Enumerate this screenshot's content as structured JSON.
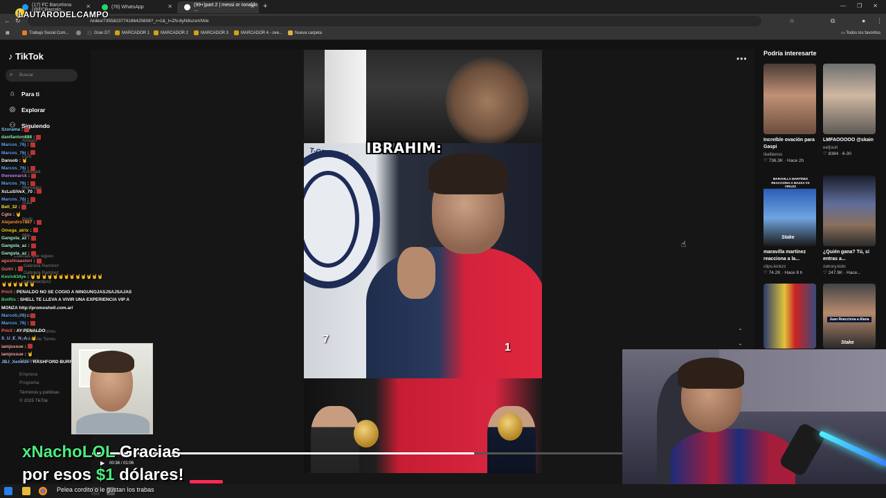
{
  "browser": {
    "tabs": [
      {
        "label": "(17) FC Barcelona (@FCBarcelo...",
        "icon_color": "#1d9bf0"
      },
      {
        "label": "(76) WhatsApp",
        "icon_color": "#25d366"
      },
      {
        "label": "(99+)part 2 | messi or ronaldo ...",
        "icon_color": "#ffffff"
      }
    ],
    "url": "/video/7355823774186425606?_r=1&_t=ZN-8yN8szsmNVe",
    "bookmarks": [
      "Trabajo Social Com...",
      "Gran DT",
      "MARCADOR 1",
      "MARCADOR 2",
      "MARCADOR 3",
      "MARCADOR 4 - ove...",
      "Nueva carpeta"
    ],
    "all_bookmarks": "Todos los favoritos",
    "new_tab": "+"
  },
  "stream_logo": "LAUTARODELCAMPO",
  "tiktok": {
    "logo": "TikTok",
    "search_placeholder": "Buscar",
    "nav": [
      {
        "label": "Para ti",
        "icon": "home-icon"
      },
      {
        "label": "Explorar",
        "icon": "compass-icon"
      },
      {
        "label": "Siguiendo",
        "icon": "users-icon"
      }
    ],
    "faint_items": [
      "Amigos",
      "LIVE",
      "Actividad",
      "Mensajes",
      "Subir",
      "Perfil",
      "Más",
      "Cuentas que sigues",
      "Gabriela Ramírez",
      "Gabriela Ramírez",
      "gabrielaclips2",
      "Cuentas",
      "Humberto Torres",
      "Humberto Torres",
      "Acerca de",
      "Empresa",
      "Programa"
    ],
    "footer_terms": "Términos y políticas",
    "footer_copyright": "© 2025 TikTok",
    "more_menu": "•••",
    "video": {
      "caption": "IBRAHIM:",
      "left_number": "7",
      "right_number": "1",
      "psg_text": "T-GERMAIN",
      "time": "00:38 / 01:06",
      "progress_fraction": 0.72
    },
    "recommended_title": "Podría interesarte",
    "recommended": [
      {
        "title": "Increíble ovación para Gaspi",
        "author": "iballlanos",
        "stats": "736.3K · Hace 2h"
      },
      {
        "title": "LMFAOOOOO @skain",
        "author": "eefjouh",
        "stats": "8384 · 6-30"
      },
      {
        "title": "maravilla martinez reacciona a la...",
        "author": "clips.kickzz",
        "stats": "74.2K · Hace 8 h"
      },
      {
        "title": "¿Quién gana? Tú, si entras a...",
        "author": "zahory.kido",
        "stats": "247.9K · Hace..."
      },
      {
        "title": "",
        "author": "",
        "stats": ""
      },
      {
        "title": "",
        "author": "",
        "stats": ""
      }
    ],
    "rec_overlay_text": "MARAVILLA MARTÍNEZ REACCIONA A MAZZA VS VIRUZZ",
    "rec_stake": "Stake",
    "rec_juan": "Juan Reacciona a Alana"
  },
  "chat": [
    {
      "user": "Szorama",
      "msg": ":",
      "color": "#7dd3fc"
    },
    {
      "user": "danifanton888",
      "msg": ":",
      "color": "#86efac"
    },
    {
      "user": "Marcos_76j",
      "msg": ":",
      "color": "#60a5fa"
    },
    {
      "user": "Marcos_76j",
      "msg": ":",
      "color": "#60a5fa"
    },
    {
      "user": "Dansob",
      "msg": ": 🤘",
      "color": "#ffffff"
    },
    {
      "user": "Marcos_76j",
      "msg": ":",
      "color": "#60a5fa"
    },
    {
      "user": "thereenarck",
      "msg": ":",
      "color": "#c084fc"
    },
    {
      "user": "Marcos_76j",
      "msg": ":",
      "color": "#60a5fa"
    },
    {
      "user": "XcLuSiVeX_70",
      "msg": ":",
      "color": "#ffffff"
    },
    {
      "user": "Marcos_76j",
      "msg": ":",
      "color": "#60a5fa"
    },
    {
      "user": "Bell_32",
      "msg": ":",
      "color": "#fde047"
    },
    {
      "user": "Cgto",
      "msg": ": 🤘",
      "color": "#fca5a5"
    },
    {
      "user": "Alejandro7887",
      "msg": ":",
      "color": "#fb923c"
    },
    {
      "user": "Omega_atrix",
      "msg": ":",
      "color": "#facc15"
    },
    {
      "user": "Gangsta_az",
      "msg": ":",
      "color": "#a7f3d0"
    },
    {
      "user": "Gangsta_az",
      "msg": ":",
      "color": "#a7f3d0"
    },
    {
      "user": "Gangsta_az",
      "msg": ":",
      "color": "#a7f3d0"
    },
    {
      "user": "agustinaastori",
      "msg": ":",
      "color": "#f87171"
    },
    {
      "user": "Guitri",
      "msg": ":",
      "color": "#f87171"
    },
    {
      "user": "Kevin634ye",
      "msg": ": 🤘🤘🤘🤘🤘🤘🤘🤘🤘🤘🤘🤘🤘",
      "color": "#4ade80"
    },
    {
      "user": "",
      "msg": "🤘🤘🤘🤘🤘🤘",
      "color": "#ffffff"
    },
    {
      "user": "Pricil",
      "msg": ": PENALDO NO SE COGIO A NINGUNOJASJSAJSAJAS",
      "color": "#f87171"
    },
    {
      "user": "BotRix",
      "msg": ": SHELL TE LLEVA A VIVIR UNA EXPERIENCIA VIP A",
      "color": "#4ade80"
    },
    {
      "user": "",
      "msg": "MONZA http://promoshell.com.ar/",
      "color": "#ffffff"
    },
    {
      "user": "Marcos_76j",
      "msg": ":",
      "color": "#60a5fa"
    },
    {
      "user": "Marcos_76j",
      "msg": ":",
      "color": "#60a5fa"
    },
    {
      "user": "Pricil",
      "msg": ": AY PENALDO",
      "color": "#f87171"
    },
    {
      "user": "S_U_E_N_A",
      "msg": ": 🤘",
      "color": "#a5b4fc"
    },
    {
      "user": "iamjossue",
      "msg": ":",
      "color": "#fca5a5"
    },
    {
      "user": "iamjossue",
      "msg": ": 🤘",
      "color": "#fca5a5"
    },
    {
      "user": "JBJ_Xenelze",
      "msg": ": RASHFORD BURRO",
      "color": "#93c5fd"
    }
  ],
  "alert": {
    "name": "xNachoLOL",
    "line1_rest": " Gracias",
    "line2_pre": "por esos ",
    "amount": "$1",
    "line2_post": " dólares!"
  },
  "ticker": "Pelea cordito o le gustan los trabas",
  "colors": {
    "accent": "#4eea7e",
    "alert_bar": "#ff2a55",
    "tiktok_bg": "#121212"
  }
}
